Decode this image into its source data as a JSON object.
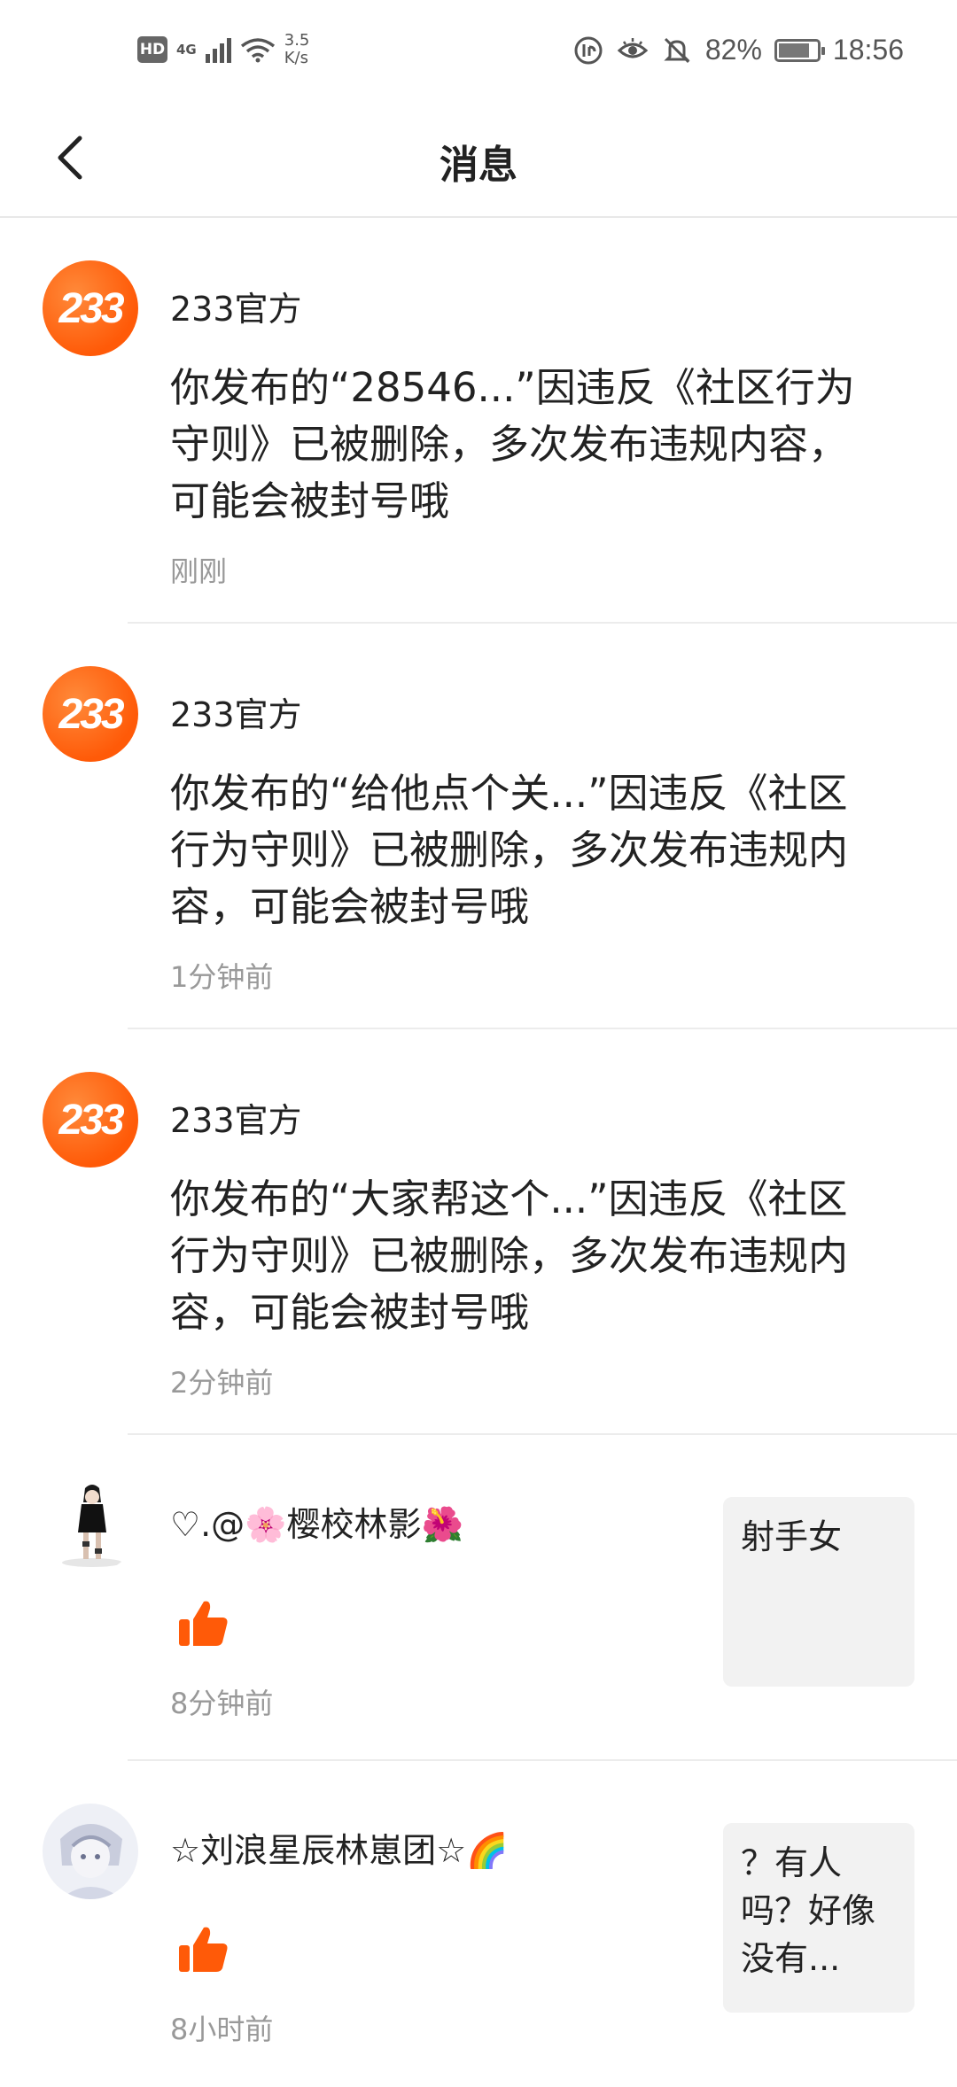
{
  "status_bar": {
    "hd": "HD",
    "network": "4G",
    "speed_value": "3.5",
    "speed_unit": "K/s",
    "battery": "82%",
    "battery_level": 0.82,
    "time": "18:56"
  },
  "header": {
    "title": "消息"
  },
  "messages": [
    {
      "name": "233官方",
      "avatar_text": "233",
      "content": "你发布的“28546...”因违反《社区行为守则》已被删除，多次发布违规内容，可能会被封号哦",
      "time": "刚刚"
    },
    {
      "name": "233官方",
      "avatar_text": "233",
      "content": "你发布的“给他点个关...”因违反《社区行为守则》已被删除，多次发布违规内容，可能会被封号哦",
      "time": "1分钟前"
    },
    {
      "name": "233官方",
      "avatar_text": "233",
      "content": "你发布的“大家帮这个...”因违反《社区行为守则》已被删除，多次发布违规内容，可能会被封号哦",
      "time": "2分钟前"
    },
    {
      "name": "♡.@🌸樱校林影🌺",
      "quote": "射手女",
      "time": "8分钟前"
    },
    {
      "name": "☆刘浪星辰林崽团☆🌈",
      "quote": "？有人吗？好像没有...",
      "time": "8小时前"
    }
  ],
  "colors": {
    "accent": "#ff5a08",
    "like": "#ff5a08",
    "time_text": "#999999",
    "quote_bg": "#f2f2f2"
  }
}
